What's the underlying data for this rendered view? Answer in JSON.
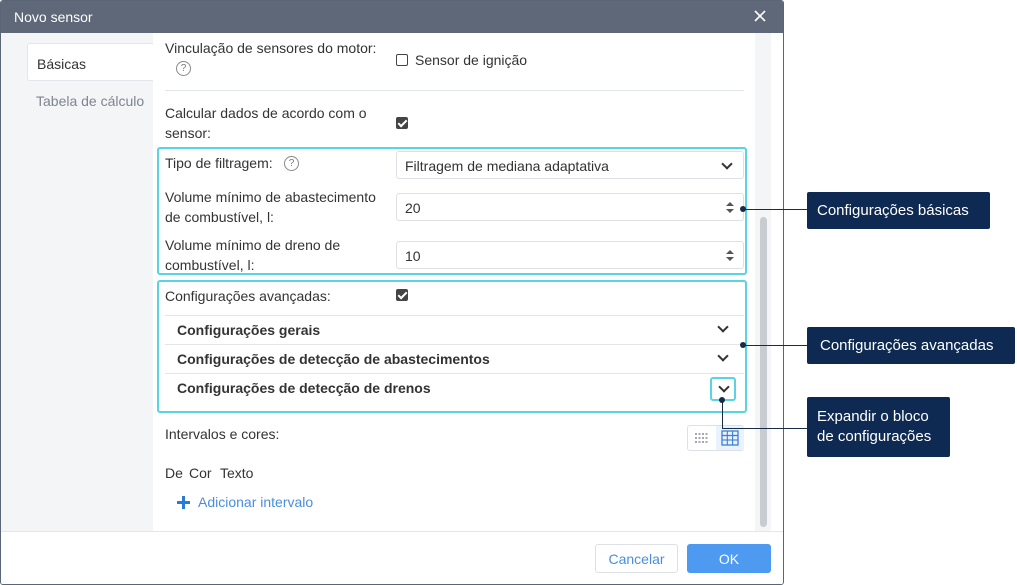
{
  "dialog": {
    "title": "Novo sensor",
    "tabs": [
      {
        "label": "Básicas",
        "active": true
      },
      {
        "label": "Tabela de cálculo",
        "active": false
      }
    ]
  },
  "fields": {
    "engine_binding": {
      "label": "Vinculação de sensores do motor:",
      "checkbox_label": "Sensor de ignição",
      "checked": false
    },
    "calc_by_sensor": {
      "label": "Calcular dados de acordo com o sensor:",
      "checked": true
    },
    "filter_type": {
      "label": "Tipo de filtragem:",
      "value": "Filtragem de mediana adaptativa"
    },
    "min_fill": {
      "label": "Volume mínimo de abastecimento de combustível, l:",
      "value": "20"
    },
    "min_drain": {
      "label": "Volume mínimo de dreno de combustível, l:",
      "value": "10"
    },
    "advanced": {
      "label": "Configurações avançadas:",
      "checked": true
    },
    "sections": [
      "Configurações gerais",
      "Configurações de detecção de abastecimentos",
      "Configurações de detecção de drenos"
    ],
    "intervals": {
      "label": "Intervalos e cores:",
      "columns": [
        "De",
        "Cor",
        "Texto"
      ],
      "add_label": "Adicionar intervalo"
    }
  },
  "footer": {
    "cancel": "Cancelar",
    "ok": "OK"
  },
  "callouts": {
    "basic": "Configurações básicas",
    "advanced": "Configurações avançadas",
    "expand_line1": "Expandir o bloco",
    "expand_line2": "de configurações"
  },
  "colors": {
    "highlight": "#5bd4e1",
    "callout_bg": "#0e2a52",
    "titlebar": "#5e6878",
    "primary": "#4e9af1",
    "link": "#4a8ee0"
  },
  "icons": [
    "close-icon",
    "help-icon",
    "chevron-down-icon",
    "spinner-icon",
    "plus-icon",
    "list-view-icon",
    "table-view-icon"
  ]
}
